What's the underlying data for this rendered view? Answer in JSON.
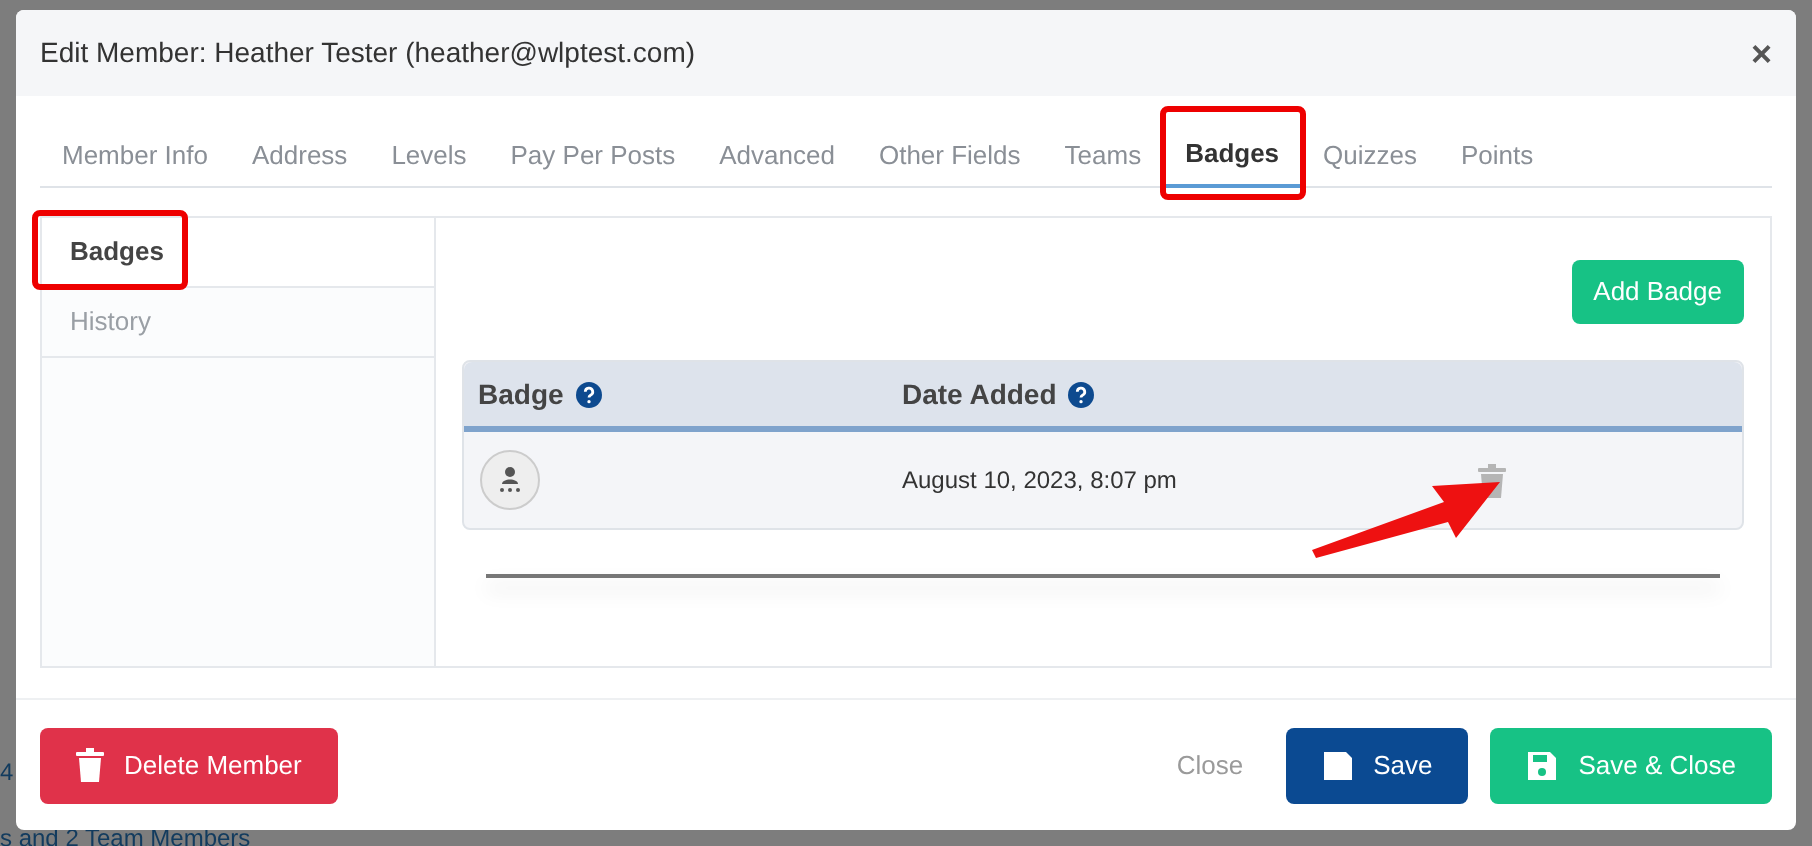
{
  "background": {
    "fragment_1": "4",
    "fragment_2": "s and 2 Team Members"
  },
  "dialog": {
    "title": "Edit Member: Heather Tester (heather@wlptest.com)",
    "close": "×"
  },
  "tabs": [
    {
      "label": "Member Info",
      "selected": false,
      "highlighted": false
    },
    {
      "label": "Address",
      "selected": false,
      "highlighted": false
    },
    {
      "label": "Levels",
      "selected": false,
      "highlighted": false
    },
    {
      "label": "Pay Per Posts",
      "selected": false,
      "highlighted": false
    },
    {
      "label": "Advanced",
      "selected": false,
      "highlighted": false
    },
    {
      "label": "Other Fields",
      "selected": false,
      "highlighted": false
    },
    {
      "label": "Teams",
      "selected": false,
      "highlighted": false
    },
    {
      "label": "Badges",
      "selected": true,
      "highlighted": true
    },
    {
      "label": "Quizzes",
      "selected": false,
      "highlighted": false
    },
    {
      "label": "Points",
      "selected": false,
      "highlighted": false
    }
  ],
  "sidebar": {
    "items": [
      {
        "label": "Badges",
        "selected": true,
        "highlighted": true
      },
      {
        "label": "History",
        "selected": false,
        "highlighted": false
      }
    ]
  },
  "add_button": "Add Badge",
  "table": {
    "columns": [
      {
        "label": "Badge",
        "help": true
      },
      {
        "label": "Date Added",
        "help": true
      }
    ],
    "rows": [
      {
        "date": "August 10, 2023, 8:07 pm"
      }
    ]
  },
  "footer": {
    "delete": "Delete Member",
    "close": "Close",
    "save": "Save",
    "save_close": "Save & Close"
  }
}
